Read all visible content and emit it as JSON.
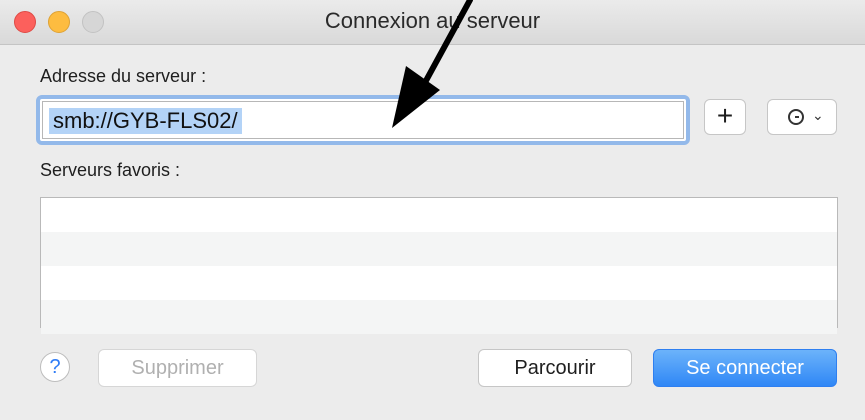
{
  "window": {
    "title": "Connexion au serveur"
  },
  "address": {
    "label": "Adresse du serveur :",
    "value": "smb://GYB-FLS02/"
  },
  "toolbar": {
    "add_label": "+",
    "history_icon": "clock-icon",
    "history_chevron": "⌄"
  },
  "favorites": {
    "label": "Serveurs favoris :",
    "items": []
  },
  "footer": {
    "help_label": "?",
    "delete_label": "Supprimer",
    "browse_label": "Parcourir",
    "connect_label": "Se connecter"
  },
  "colors": {
    "accent": "#2f87f6",
    "selection": "#b3d3f7",
    "focus_ring": "#93b9ea",
    "annotation_arrow": "#000000"
  }
}
